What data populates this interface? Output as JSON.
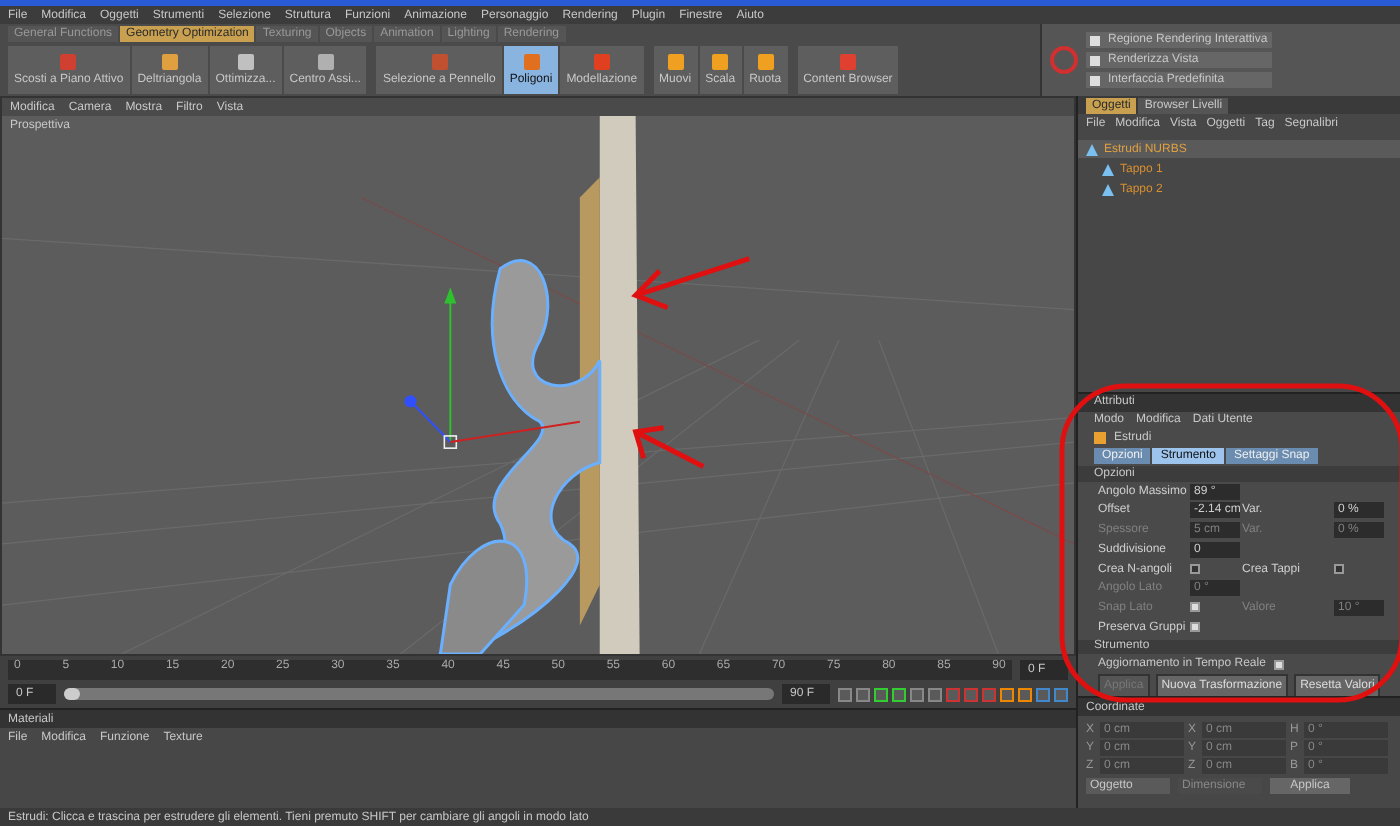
{
  "menu": [
    "File",
    "Modifica",
    "Oggetti",
    "Strumenti",
    "Selezione",
    "Struttura",
    "Funzioni",
    "Animazione",
    "Personaggio",
    "Rendering",
    "Plugin",
    "Finestre",
    "Aiuto"
  ],
  "palette_tabs": [
    {
      "label": "General Functions",
      "selected": false
    },
    {
      "label": "Geometry Optimization",
      "selected": true
    },
    {
      "label": "Texturing",
      "selected": false
    },
    {
      "label": "Objects",
      "selected": false
    },
    {
      "label": "Animation",
      "selected": false
    },
    {
      "label": "Lighting",
      "selected": false
    },
    {
      "label": "Rendering",
      "selected": false
    }
  ],
  "toolbar": [
    {
      "groups": [
        {
          "label": "Scosti a Piano Attivo",
          "color": "#d04030",
          "selected": false
        },
        {
          "label": "Deltriangola",
          "color": "#e0a040",
          "selected": false
        },
        {
          "label": "Ottimizza...",
          "color": "#c0c0c0",
          "selected": false
        },
        {
          "label": "Centro Assi...",
          "color": "#b0b0b0",
          "selected": false
        }
      ]
    },
    {
      "groups": [
        {
          "label": "Selezione a Pennello",
          "color": "#c05030",
          "selected": false
        },
        {
          "label": "Poligoni",
          "color": "#e07020",
          "selected": true
        },
        {
          "label": "Modellazione",
          "color": "#e04020",
          "selected": false
        }
      ]
    },
    {
      "groups": [
        {
          "label": "Muovi",
          "color": "#f0a020",
          "selected": false
        },
        {
          "label": "Scala",
          "color": "#f0a020",
          "selected": false
        },
        {
          "label": "Ruota",
          "color": "#f0a020",
          "selected": false
        }
      ]
    },
    {
      "groups": [
        {
          "label": "Content Browser",
          "color": "#e04030",
          "selected": false
        }
      ]
    }
  ],
  "layouts": [
    "Regione Rendering Interattiva",
    "Renderizza Vista",
    "Interfaccia Predefinita"
  ],
  "viewport": {
    "menu": [
      "Modifica",
      "Camera",
      "Mostra",
      "Filtro",
      "Vista"
    ],
    "label": "Prospettiva"
  },
  "objects": {
    "tabs": [
      {
        "label": "Oggetti",
        "selected": true
      },
      {
        "label": "Browser Livelli",
        "selected": false
      }
    ],
    "menu": [
      "File",
      "Modifica",
      "Vista",
      "Oggetti",
      "Tag",
      "Segnalibri"
    ],
    "tree": [
      {
        "name": "Estrudi NURBS",
        "selected": true,
        "children": [
          {
            "name": "Tappo 1",
            "selected": false
          },
          {
            "name": "Tappo 2",
            "selected": false
          }
        ]
      }
    ]
  },
  "attributes": {
    "title": "Attributi",
    "menu": [
      "Modo",
      "Modifica",
      "Dati Utente"
    ],
    "tool": "Estrudi",
    "tabs": [
      {
        "label": "Opzioni",
        "selected": false
      },
      {
        "label": "Strumento",
        "selected": true
      },
      {
        "label": "Settaggi Snap",
        "selected": false
      }
    ],
    "section_1": "Opzioni",
    "rows": [
      [
        {
          "kind": "field",
          "label": "Angolo Massimo",
          "value": "89 °",
          "disabled": false
        }
      ],
      [
        {
          "kind": "field",
          "label": "Offset",
          "value": "-2.14 cm",
          "disabled": false
        },
        {
          "kind": "field",
          "label": "Var.",
          "value": "0 %",
          "disabled": false
        }
      ],
      [
        {
          "kind": "field",
          "label": "Spessore",
          "value": "5 cm",
          "disabled": true
        },
        {
          "kind": "field",
          "label": "Var.",
          "value": "0 %",
          "disabled": true
        }
      ],
      [
        {
          "kind": "field",
          "label": "Suddivisione",
          "value": "0",
          "disabled": false
        }
      ],
      [
        {
          "kind": "check",
          "label": "Crea N-angoli",
          "checked": false,
          "disabled": false
        },
        {
          "kind": "check",
          "label": "Crea Tappi",
          "checked": false,
          "disabled": false
        }
      ],
      [
        {
          "kind": "field",
          "label": "Angolo Lato",
          "value": "0 °",
          "disabled": true
        }
      ],
      [
        {
          "kind": "check",
          "label": "Snap Lato",
          "checked": true,
          "disabled": true
        },
        {
          "kind": "field",
          "label": "Valore",
          "value": "10 °",
          "disabled": true
        }
      ],
      [
        {
          "kind": "check",
          "label": "Preserva Gruppi",
          "checked": true,
          "disabled": false
        }
      ]
    ],
    "section_2": "Strumento",
    "realtime": {
      "label": "Aggiornamento in Tempo Reale",
      "checked": true
    },
    "buttons": [
      {
        "label": "Applica",
        "disabled": true
      },
      {
        "label": "Nuova Trasformazione",
        "disabled": false
      },
      {
        "label": "Resetta Valori",
        "disabled": false
      }
    ]
  },
  "timeline": {
    "ticks": [
      "0",
      "5",
      "10",
      "15",
      "20",
      "25",
      "30",
      "35",
      "40",
      "45",
      "50",
      "55",
      "60",
      "65",
      "70",
      "75",
      "80",
      "85",
      "90"
    ],
    "current": "0 F",
    "start": "0 F",
    "end": "90 F",
    "level": 0
  },
  "materials": {
    "title": "Materiali",
    "menu": [
      "File",
      "Modifica",
      "Funzione",
      "Texture"
    ]
  },
  "coordinates": {
    "title": "Coordinate",
    "rows": [
      {
        "a": "X",
        "av": "0 cm",
        "b": "X",
        "bv": "0 cm",
        "c": "H",
        "cv": "0 °"
      },
      {
        "a": "Y",
        "av": "0 cm",
        "b": "Y",
        "bv": "0 cm",
        "c": "P",
        "cv": "0 °"
      },
      {
        "a": "Z",
        "av": "0 cm",
        "b": "Z",
        "bv": "0 cm",
        "c": "B",
        "cv": "0 °"
      }
    ],
    "mode": "Oggetto",
    "size": "Dimensione",
    "apply": "Applica"
  },
  "status": "Estrudi: Clicca e trascina per estrudere gli elementi. Tieni premuto SHIFT per cambiare gli angoli in modo lato"
}
